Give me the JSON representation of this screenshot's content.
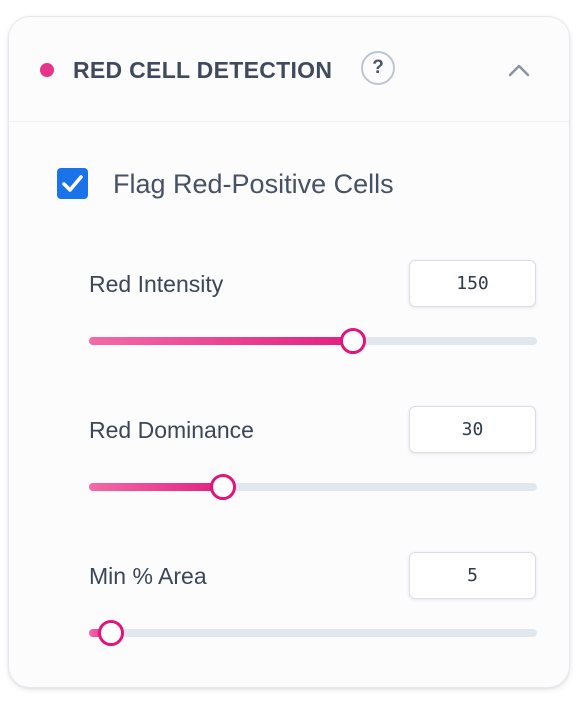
{
  "panel": {
    "title": "RED CELL DETECTION",
    "help_label": "?",
    "accent_color": "#e8338a",
    "expanded": true,
    "collapse_icon": "chevron-up-icon"
  },
  "flag": {
    "checked": true,
    "label": "Flag Red-Positive Cells",
    "color": "#1a73e8"
  },
  "sliders": [
    {
      "label": "Red Intensity",
      "value": "150",
      "fraction": 0.59
    },
    {
      "label": "Red Dominance",
      "value": "30",
      "fraction": 0.3
    },
    {
      "label": "Min % Area",
      "value": "5",
      "fraction": 0.05
    }
  ]
}
